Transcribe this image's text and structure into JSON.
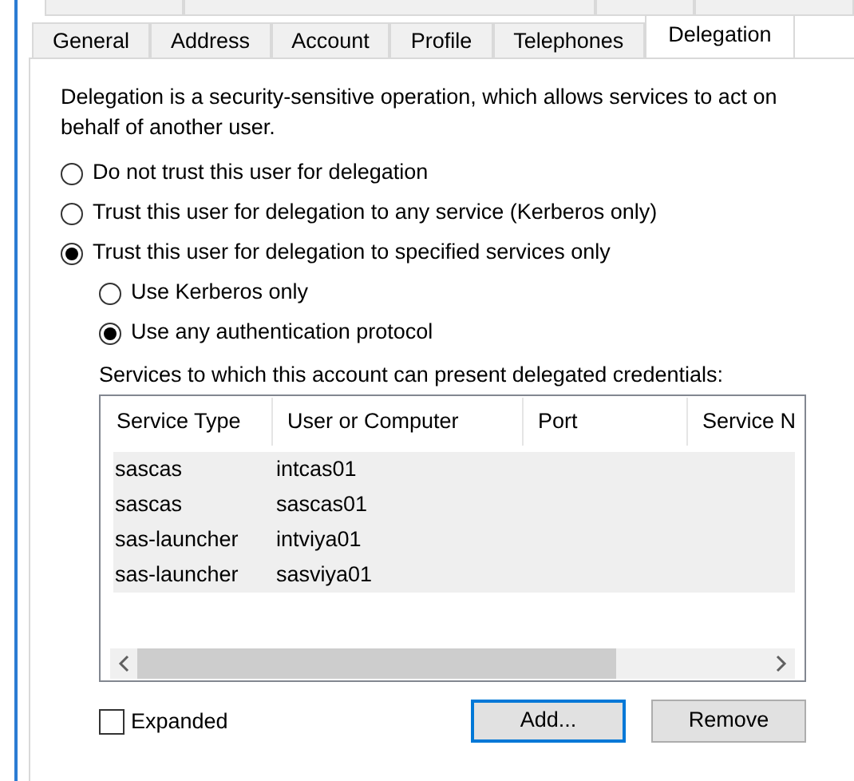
{
  "tabs": [
    {
      "label": "General",
      "selected": false
    },
    {
      "label": "Address",
      "selected": false
    },
    {
      "label": "Account",
      "selected": false
    },
    {
      "label": "Profile",
      "selected": false
    },
    {
      "label": "Telephones",
      "selected": false
    },
    {
      "label": "Delegation",
      "selected": true
    }
  ],
  "description": "Delegation is a security-sensitive operation, which allows services to act on behalf of another user.",
  "trust_options": [
    {
      "label": "Do not trust this user for delegation",
      "selected": false
    },
    {
      "label": "Trust this user for delegation to any service (Kerberos only)",
      "selected": false
    },
    {
      "label": "Trust this user for delegation to specified services only",
      "selected": true
    }
  ],
  "protocol_options": [
    {
      "label": "Use Kerberos only",
      "selected": false
    },
    {
      "label": "Use any authentication protocol",
      "selected": true
    }
  ],
  "services_label": "Services to which this account can present delegated credentials:",
  "table": {
    "columns": [
      "Service Type",
      "User or Computer",
      "Port",
      "Service N"
    ],
    "rows": [
      {
        "cells": [
          "sascas",
          "intcas01",
          "",
          ""
        ],
        "selected": true
      },
      {
        "cells": [
          "sascas",
          "sascas01",
          "",
          ""
        ],
        "selected": true
      },
      {
        "cells": [
          "sas-launcher",
          "intviya01",
          "",
          ""
        ],
        "selected": true
      },
      {
        "cells": [
          "sas-launcher",
          "sasviya01",
          "",
          ""
        ],
        "selected": true
      }
    ]
  },
  "expanded": {
    "label": "Expanded",
    "checked": false
  },
  "buttons": [
    {
      "label": "Add...",
      "focused": true
    },
    {
      "label": "Remove",
      "focused": false
    }
  ]
}
